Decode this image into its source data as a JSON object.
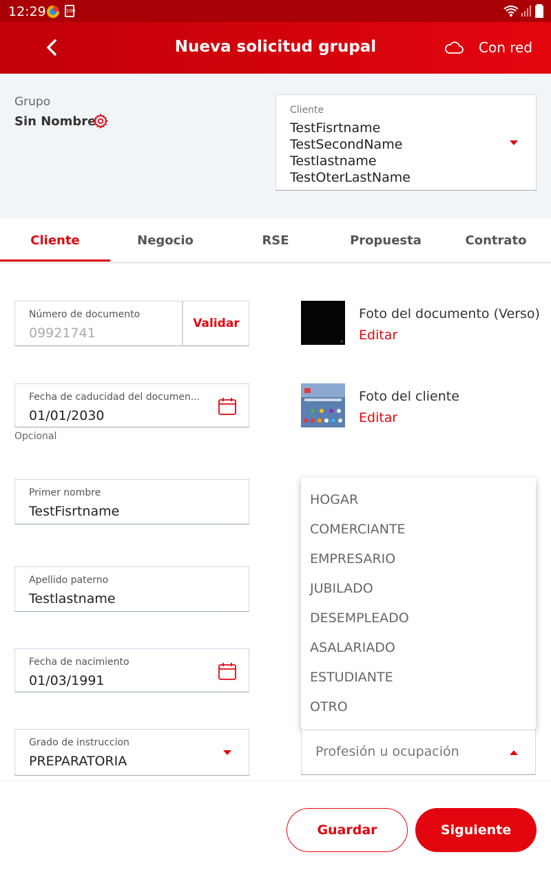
{
  "status_bar": {
    "time": "12:29",
    "battery_badge": "100"
  },
  "app_bar": {
    "title": "Nueva solicitud grupal",
    "network_status": "Con red"
  },
  "group": {
    "label": "Grupo",
    "name": "Sin Nombre"
  },
  "client_select": {
    "label": "Cliente",
    "lines": [
      "TestFisrtname",
      "TestSecondName",
      "Testlastname",
      "TestOterLastName"
    ]
  },
  "tabs": [
    {
      "label": "Cliente",
      "active": true
    },
    {
      "label": "Negocio",
      "active": false
    },
    {
      "label": "RSE",
      "active": false
    },
    {
      "label": "Propuesta",
      "active": false
    },
    {
      "label": "Contrato",
      "active": false
    }
  ],
  "form": {
    "document_number": {
      "label": "Número de documento",
      "value": "09921741",
      "validate_label": "Validar"
    },
    "expiry_date": {
      "label": "Fecha de caducidad del documen...",
      "value": "01/01/2030",
      "hint": "Opcional"
    },
    "first_name": {
      "label": "Primer nombre",
      "value": "TestFisrtname"
    },
    "paternal_surname": {
      "label": "Apellido paterno",
      "value": "Testlastname"
    },
    "birth_date": {
      "label": "Fecha de nacimiento",
      "value": "01/03/1991"
    },
    "education": {
      "label": "Grado de instruccion",
      "value": "PREPARATORIA"
    },
    "profession": {
      "placeholder": "Profesión u ocupación"
    }
  },
  "photos": {
    "document": {
      "title": "Foto del documento (Verso)",
      "edit": "Editar"
    },
    "client": {
      "title": "Foto del cliente",
      "edit": "Editar"
    }
  },
  "profession_options": [
    "HOGAR",
    "COMERCIANTE",
    "EMPRESARIO",
    "JUBILADO",
    "DESEMPLEADO",
    "ASALARIADO",
    "ESTUDIANTE",
    "OTRO"
  ],
  "footer": {
    "save_label": "Guardar",
    "next_label": "Siguiente"
  },
  "colors": {
    "brand_red": "#e3050e",
    "dark_red": "#a80006",
    "panel_bg": "#f2f5f8"
  }
}
